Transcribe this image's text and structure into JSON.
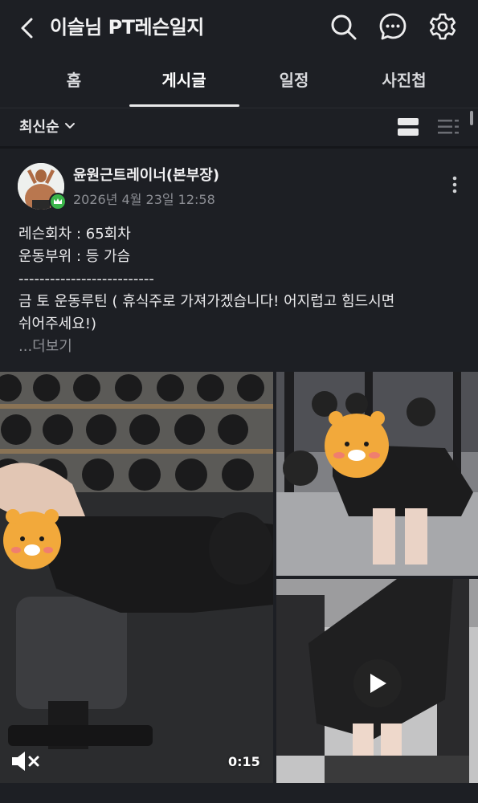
{
  "header": {
    "title": "이슬님 PT레슨일지",
    "icons": [
      "chevron-left-icon",
      "search-icon",
      "chat-bubble-icon",
      "gear-icon"
    ]
  },
  "tabs": [
    {
      "label": "홈",
      "active": false
    },
    {
      "label": "게시글",
      "active": true
    },
    {
      "label": "일정",
      "active": false
    },
    {
      "label": "사진첩",
      "active": false
    }
  ],
  "sortbar": {
    "sort_label": "최신순",
    "icons": [
      "card-view-icon",
      "list-view-icon"
    ]
  },
  "post": {
    "author": "윤원근트레이너(본부장)",
    "date": "2026년 4월 23일 12:58",
    "lines": [
      "레슨회차 : 65회차",
      "운동부위 : 등 가슴",
      "--------------------------",
      "금 토 운동루틴 ( 휴식주로 가져가겠습니다! 어지럽고 힘드시면",
      "쉬어주세요!)"
    ],
    "more_label": "...더보기",
    "video": {
      "duration": "0:15"
    }
  },
  "colors": {
    "background": "#1d1f24",
    "badge": "#3bb54a",
    "muted_text": "#8d8f95"
  }
}
